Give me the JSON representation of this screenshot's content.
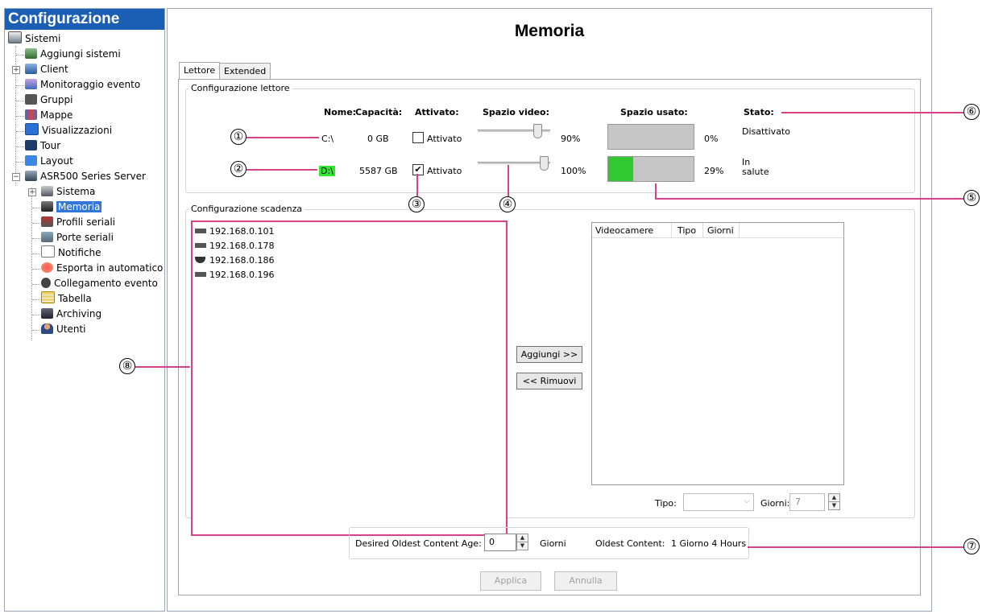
{
  "sidebar": {
    "title": "Configurazione",
    "items": [
      {
        "label": "Sistemi",
        "icon": "systems-icon"
      },
      {
        "label": "Aggiungi sistemi",
        "icon": "add-system-icon"
      },
      {
        "label": "Client",
        "icon": "client-icon"
      },
      {
        "label": "Monitoraggio evento",
        "icon": "event-monitoring-icon"
      },
      {
        "label": "Gruppi",
        "icon": "groups-icon"
      },
      {
        "label": "Mappe",
        "icon": "maps-icon"
      },
      {
        "label": "Visualizzazioni",
        "icon": "views-icon"
      },
      {
        "label": "Tour",
        "icon": "tour-icon"
      },
      {
        "label": "Layout",
        "icon": "layout-icon"
      },
      {
        "label": "ASR500 Series Server",
        "icon": "server-icon"
      },
      {
        "label": "Sistema",
        "icon": "system-icon"
      },
      {
        "label": "Memoria",
        "icon": "storage-icon"
      },
      {
        "label": "Profili seriali",
        "icon": "serial-profiles-icon"
      },
      {
        "label": "Porte seriali",
        "icon": "serial-ports-icon"
      },
      {
        "label": "Notifiche",
        "icon": "notifications-icon"
      },
      {
        "label": "Esporta in automatico",
        "icon": "auto-export-icon"
      },
      {
        "label": "Collegamento evento",
        "icon": "event-link-icon"
      },
      {
        "label": "Tabella",
        "icon": "table-icon"
      },
      {
        "label": "Archiving",
        "icon": "archiving-icon"
      },
      {
        "label": "Utenti",
        "icon": "users-icon"
      }
    ],
    "selected": "Memoria"
  },
  "page": {
    "title": "Memoria",
    "tabs": [
      "Lettore",
      "Extended"
    ]
  },
  "drives": {
    "group_label": "Configurazione lettore",
    "headers": {
      "name": "Nome:",
      "capacity": "Capacità:",
      "enabled": "Attivato:",
      "video_space": "Spazio video:",
      "used_space": "Spazio usato:",
      "status": "Stato:"
    },
    "rows": [
      {
        "name": "C:\\",
        "capacity": "0 GB",
        "enabled_label": "Attivato",
        "enabled": false,
        "video_space": "90%",
        "video_space_value": 0.9,
        "used": "0%",
        "used_value": 0,
        "status": "Disattivato"
      },
      {
        "name": "D:\\",
        "capacity": "5587 GB",
        "enabled_label": "Attivato",
        "enabled": true,
        "video_space": "100%",
        "video_space_value": 1.0,
        "used": "29%",
        "used_value": 0.29,
        "status_line1": "In",
        "status_line2": "salute"
      }
    ],
    "colors": {
      "used_fill": "#32c832",
      "name_highlight": "#32e632"
    }
  },
  "expiry": {
    "group_label": "Configurazione scadenza",
    "cameras": [
      "192.168.0.101",
      "192.168.0.178",
      "192.168.0.186",
      "192.168.0.196"
    ],
    "add_button": "Aggiungi >>",
    "remove_button": "<< Rimuovi",
    "table_columns": [
      "Videocamere",
      "Tipo",
      "Giorni"
    ],
    "type_label": "Tipo:",
    "days_label": "Giorni:",
    "days_value": "7"
  },
  "bottom": {
    "desired_label": "Desired Oldest Content Age:",
    "desired_value": "0",
    "desired_unit": "Giorni",
    "oldest_label": "Oldest Content:",
    "oldest_value": "1 Giorno 4 Hours",
    "apply": "Applica",
    "cancel": "Annulla"
  },
  "callouts": [
    "①",
    "②",
    "③",
    "④",
    "⑤",
    "⑥",
    "⑦",
    "⑧"
  ],
  "accent_color": "#d6428a"
}
